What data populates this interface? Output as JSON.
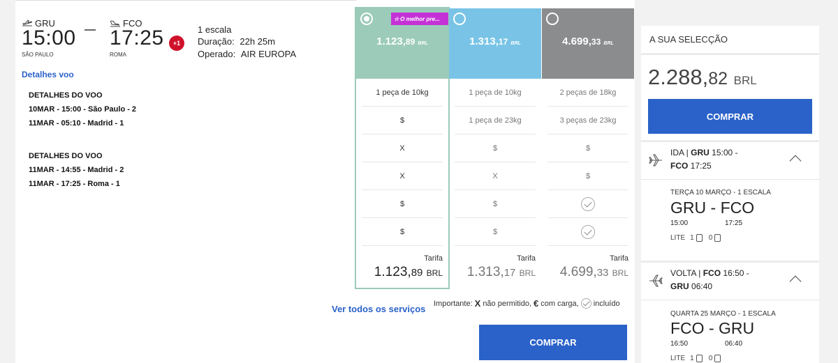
{
  "flight": {
    "origin_code": "GRU",
    "dest_code": "FCO",
    "depart_time": "15:00",
    "arrive_time": "17:25",
    "origin_city": "SÃO PAULO",
    "dest_city": "ROMA",
    "day_offset": "+1",
    "stops": "1 escala",
    "duration_label": "Duração:",
    "duration": "22h 25m",
    "operated_label": "Operado:",
    "operator": "AIR EUROPA",
    "details_link": "Detalhes voo"
  },
  "details": [
    {
      "title": "DETALHES DO VOO",
      "lines": [
        {
          "date": "10MAR",
          "text": " - 15:00 - São Paulo - 2"
        },
        {
          "date": "11MAR",
          "text": " - 05:10 - Madrid - 1"
        }
      ]
    },
    {
      "title": "DETALHES DO VOO",
      "lines": [
        {
          "date": "11MAR",
          "text": " - 14:55 - Madrid - 2"
        },
        {
          "date": "11MAR",
          "text": " - 17:25 - Roma - 1"
        }
      ]
    }
  ],
  "fares": [
    {
      "color": "#9ccbb9",
      "selected": true,
      "badge": "O melhor pre...",
      "price_int": "1.123,",
      "price_dec": "89",
      "currency": "BRL",
      "cells": [
        "1 peça de 10kg",
        "$",
        "X",
        "X",
        "$",
        "$"
      ],
      "total_label": "Tarifa",
      "total_int": "1.123,",
      "total_dec": "89",
      "total_cur": "BRL"
    },
    {
      "color": "#79c4e6",
      "selected": false,
      "badge": "",
      "price_int": "1.313,",
      "price_dec": "17",
      "currency": "BRL",
      "cells": [
        "1 peça de 10kg",
        "1 peça de 23kg",
        "$",
        "X",
        "$",
        "$"
      ],
      "total_label": "Tarifa",
      "total_int": "1.313,",
      "total_dec": "17",
      "total_cur": "BRL"
    },
    {
      "color": "#8a8c8e",
      "selected": false,
      "badge": "",
      "price_int": "4.699,",
      "price_dec": "33",
      "currency": "BRL",
      "cells": [
        "2 peças de 18kg",
        "3 peças de 23kg",
        "$",
        "$",
        "check",
        "check"
      ],
      "total_label": "Tarifa",
      "total_int": "4.699,",
      "total_dec": "33",
      "total_cur": "BRL"
    }
  ],
  "see_all": "Ver todos os serviços",
  "legend": {
    "prefix": "Importante:",
    "x_symbol": "X",
    "x_text": "não permitido,",
    "e_symbol": "€",
    "e_text": "com carga,",
    "check_text": "incluído"
  },
  "buy_label": "COMPRAR",
  "sidebar": {
    "title": "A SUA SELECÇÃO",
    "total_int": "2.288,",
    "total_dec": "82",
    "total_cur": "BRL",
    "buy_label": "COMPRAR",
    "legs": [
      {
        "kind": "IDA",
        "from": "GRU",
        "from_time": "15:00",
        "to": "FCO",
        "to_time": "17:25",
        "date": "TERÇA 10 MARÇO - 1 ESCALA",
        "route_from": "GRU",
        "route_to": "FCO",
        "dep": "15:00",
        "arr": "17:25",
        "fare": "LITE",
        "bag1": "1",
        "bag2": "0"
      },
      {
        "kind": "VOLTA",
        "from": "FCO",
        "from_time": "16:50",
        "to": "GRU",
        "to_time": "06:40",
        "date": "QUARTA 25 MARÇO - 1 ESCALA",
        "route_from": "FCO",
        "route_to": "GRU",
        "dep": "16:50",
        "arr": "06:40",
        "fare": "LITE",
        "bag1": "1",
        "bag2": "0"
      }
    ]
  }
}
